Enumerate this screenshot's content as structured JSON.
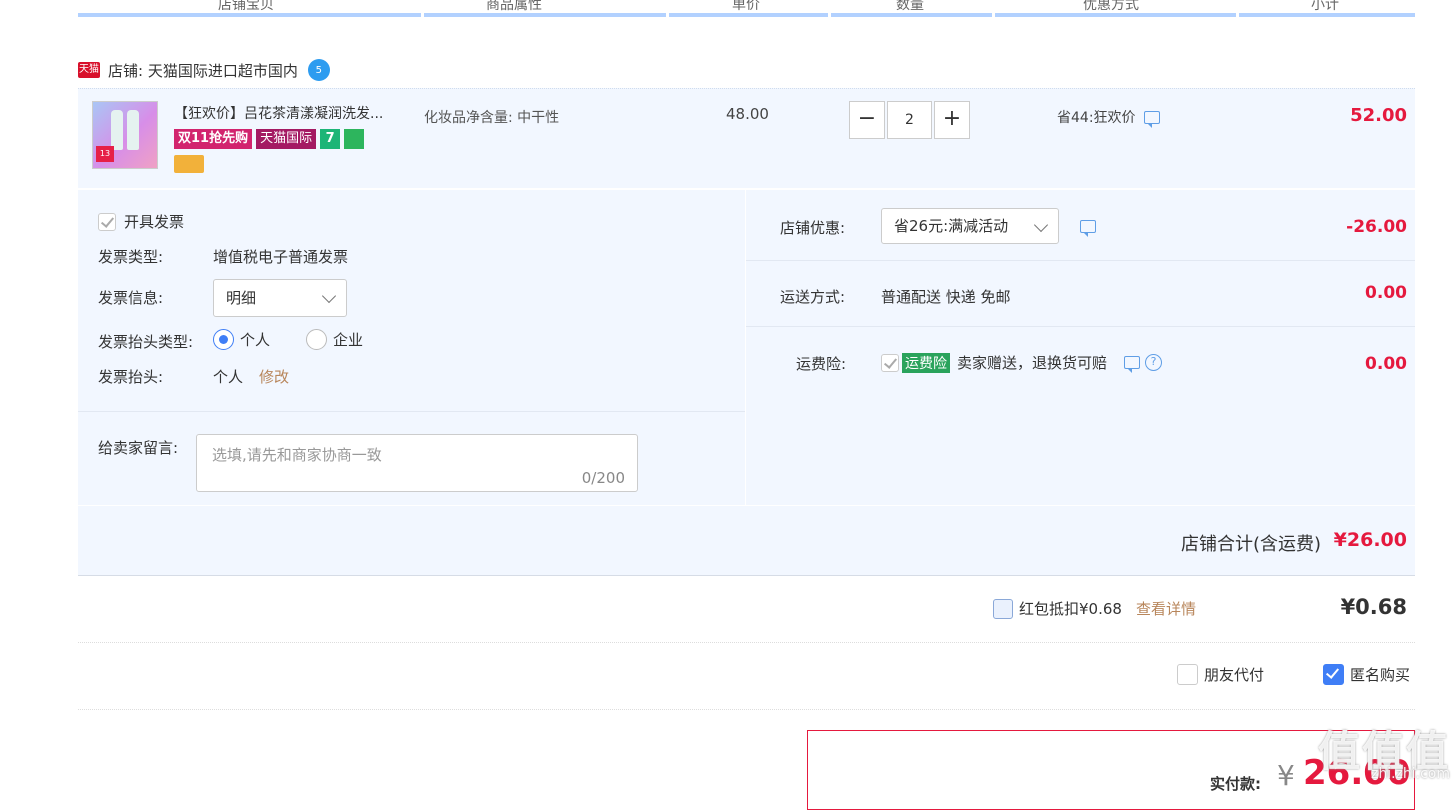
{
  "header": {
    "columns": [
      "店铺宝贝",
      "商品属性",
      "单价",
      "数量",
      "优惠方式",
      "小计"
    ]
  },
  "shop": {
    "badge": "天猫",
    "label": "店铺: ",
    "name": "天猫国际进口超市国内",
    "wangwang": "5"
  },
  "item": {
    "title": "【狂欢价】吕花茶清漾凝润洗发...",
    "thumb_tag": "13",
    "badges": [
      "双11抢先购",
      "天猫国际",
      "7"
    ],
    "attribute": "化妆品净含量: 中干性",
    "unit_price": "48.00",
    "quantity": "2",
    "minus": "−",
    "plus": "+",
    "discount": "省44:狂欢价",
    "subtotal": "52.00"
  },
  "invoice": {
    "open_label": "开具发票",
    "type_label": "发票类型:",
    "type_value": "增值税电子普通发票",
    "info_label": "发票信息:",
    "info_value": "明细",
    "title_type_label": "发票抬头类型:",
    "option_personal": "个人",
    "option_company": "企业",
    "title_label": "发票抬头:",
    "title_value": "个人",
    "modify": "修改"
  },
  "message": {
    "label": "给卖家留言:",
    "placeholder": "选填,请先和商家协商一致",
    "counter": "0/200"
  },
  "shop_discount": {
    "label": "店铺优惠:",
    "value": "省26元:满减活动",
    "amount": "-26.00"
  },
  "shipping": {
    "label": "运送方式:",
    "value": "普通配送 快递 免邮",
    "amount": "0.00"
  },
  "insurance": {
    "label": "运费险:",
    "tag": "运费险",
    "text": "卖家赠送，退换货可赔",
    "help": "?",
    "amount": "0.00"
  },
  "shop_total": {
    "label": "店铺合计(含运费)",
    "value": "¥26.00"
  },
  "red_packet": {
    "label": "红包抵扣¥0.68",
    "link": "查看详情",
    "amount": "¥0.68"
  },
  "options": {
    "friend_pay": "朋友代付",
    "anonymous": "匿名购买"
  },
  "payment": {
    "label": "实付款:",
    "currency": "¥",
    "amount": "26.00"
  },
  "watermark": {
    "main": "值值值",
    "sub": "zhi.zhi.com"
  },
  "colors": {
    "accent_red": "#e5193e",
    "accent_blue": "#3f7ef6",
    "panel_bg": "#f2f7ff"
  }
}
